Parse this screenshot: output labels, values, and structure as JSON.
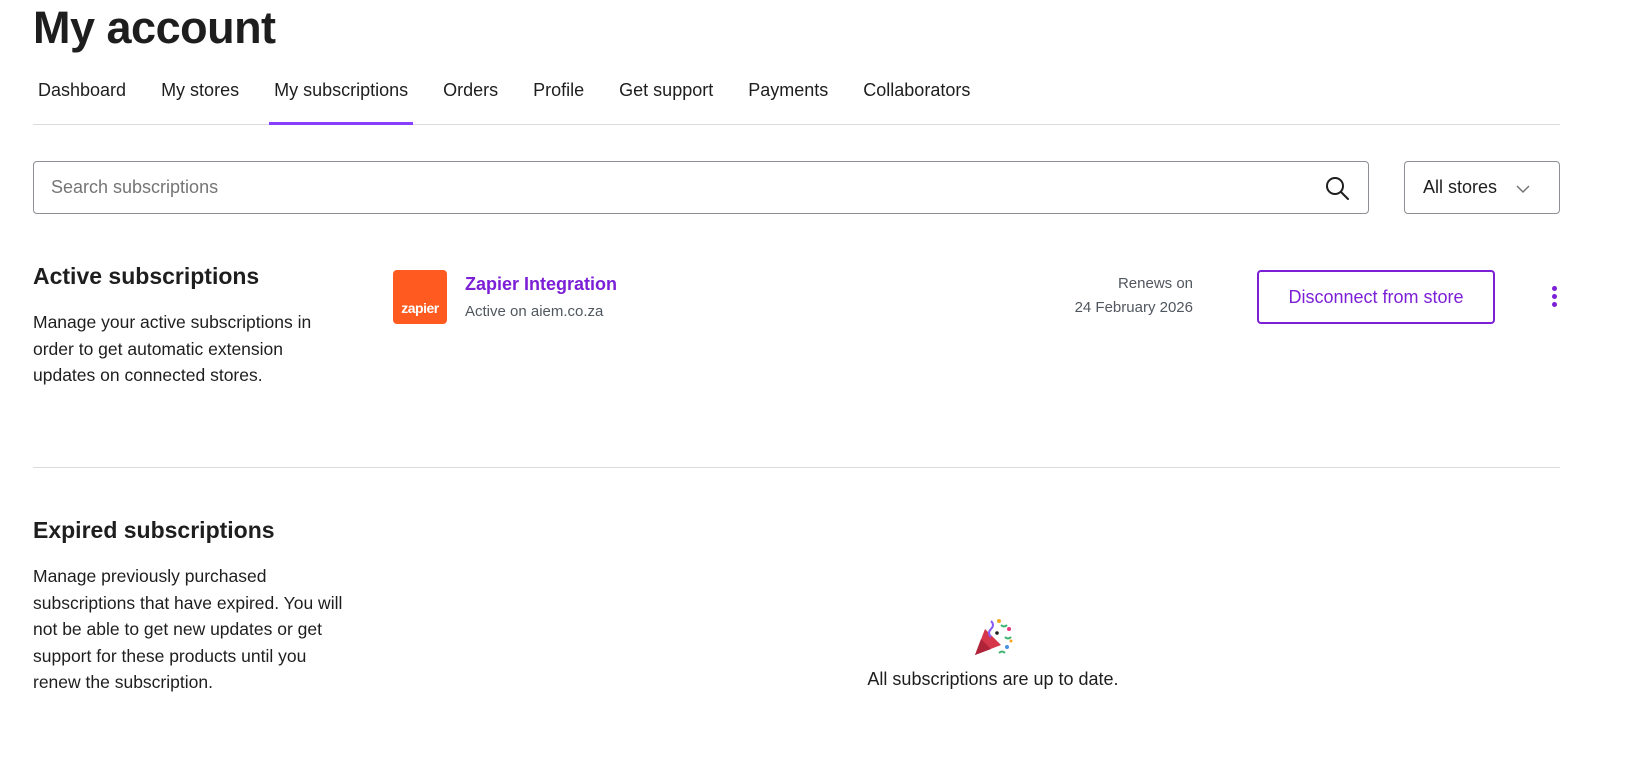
{
  "header": {
    "title": "My account"
  },
  "tabs": [
    {
      "label": "Dashboard"
    },
    {
      "label": "My stores"
    },
    {
      "label": "My subscriptions",
      "active": true
    },
    {
      "label": "Orders"
    },
    {
      "label": "Profile"
    },
    {
      "label": "Get support"
    },
    {
      "label": "Payments"
    },
    {
      "label": "Collaborators"
    }
  ],
  "search": {
    "value": "",
    "placeholder": "Search subscriptions",
    "icon": "search-icon"
  },
  "store_filter": {
    "selected": "All stores",
    "icon": "chevron-down-icon"
  },
  "active_section": {
    "title": "Active subscriptions",
    "description": "Manage your active subscriptions in order to get automatic extension updates on connected stores."
  },
  "subscription": {
    "logo_text": "zapier",
    "logo_color": "#ff5a1f",
    "name": "Zapier Integration",
    "status": "Active on aiem.co.za",
    "renews_label": "Renews on",
    "renews_date": "24 February 2026",
    "action_label": "Disconnect from store",
    "more_icon": "vertical-ellipsis-icon"
  },
  "expired_section": {
    "title": "Expired subscriptions",
    "description": "Manage previously purchased subscriptions that have expired. You will not be able to get new updates or get support for these products until you renew the subscription."
  },
  "empty_state": {
    "icon": "party-popper-icon",
    "message": "All subscriptions are up to date."
  },
  "colors": {
    "accent": "#7c1fd6",
    "tab_underline": "#873eff",
    "divider": "#dcdcde"
  }
}
